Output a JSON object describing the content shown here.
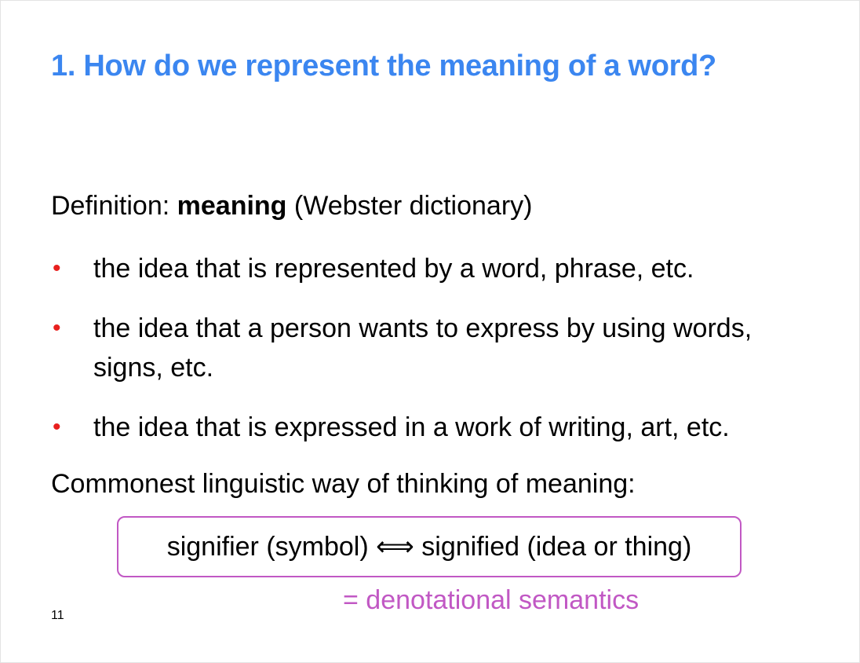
{
  "slide": {
    "title": "1. How do we represent the meaning of a word?",
    "definition": {
      "prefix": "Definition: ",
      "term": "meaning",
      "suffix": " (Webster dictionary)"
    },
    "bullet_symbol": "•",
    "bullets": [
      "the idea that is represented by a word, phrase, etc.",
      "the idea that a person wants to express by using words, signs, etc.",
      "the idea that is expressed in a work of writing, art, etc."
    ],
    "common_way": "Commonest linguistic way of thinking of meaning:",
    "signifier_box": "signifier (symbol) ⟺ signified (idea or thing)",
    "denotational": "= denotational semantics",
    "page_number": "11"
  },
  "colors": {
    "title": "#3b86f0",
    "bullet": "#e8201e",
    "accent": "#c158c4"
  }
}
